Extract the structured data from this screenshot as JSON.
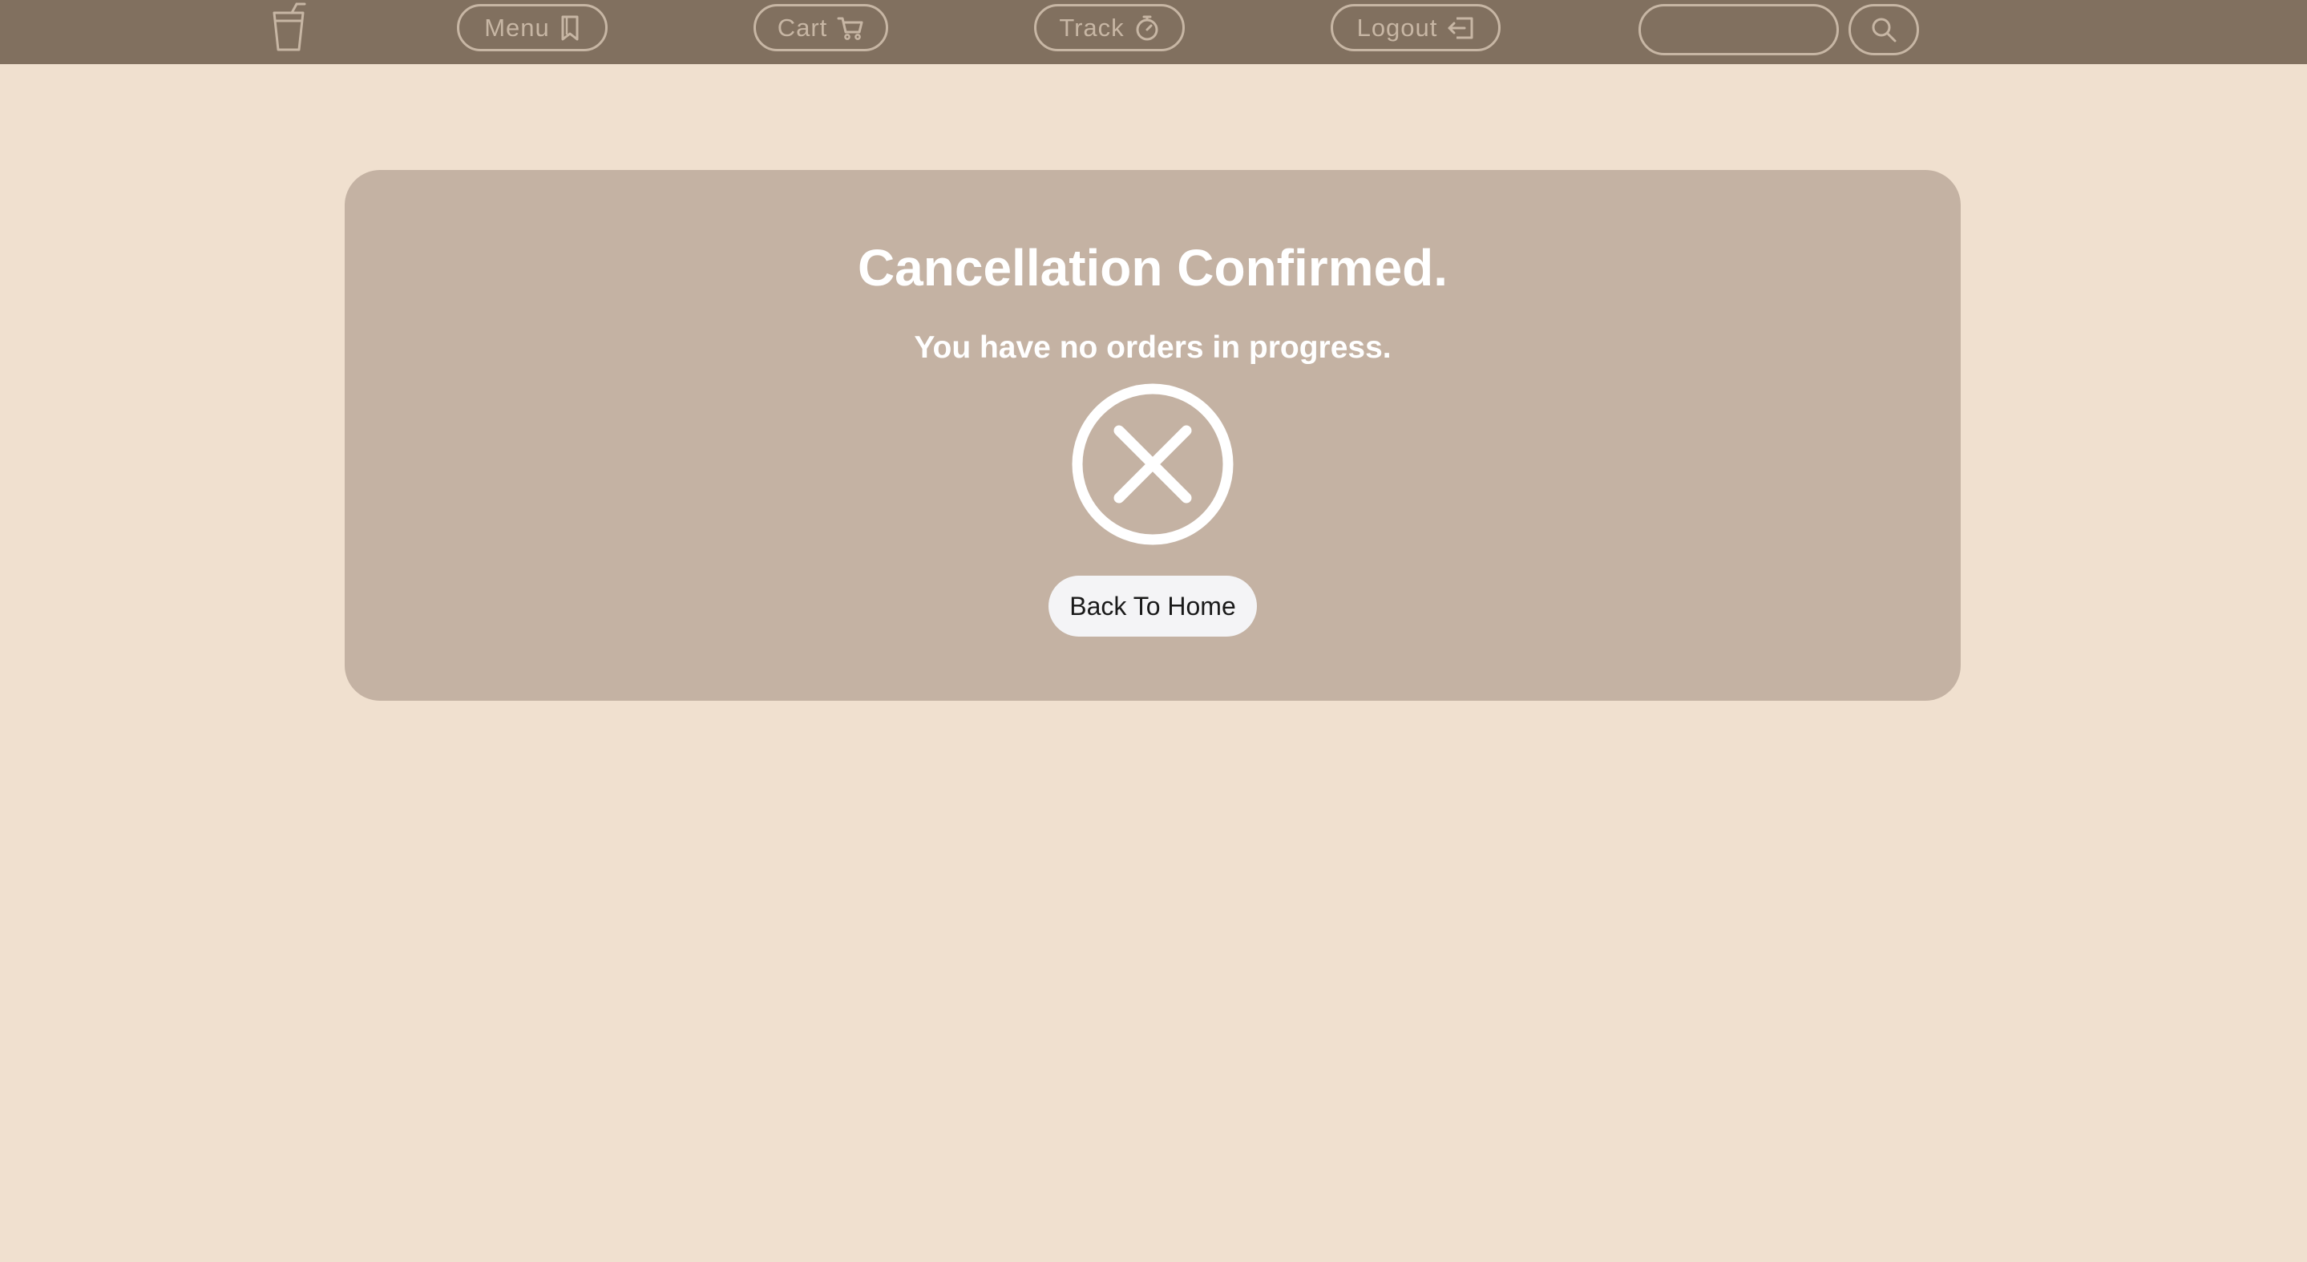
{
  "navbar": {
    "logo_icon": "cup-icon",
    "items": [
      {
        "label": "Menu",
        "icon": "bookmark-icon"
      },
      {
        "label": "Cart",
        "icon": "cart-icon"
      },
      {
        "label": "Track",
        "icon": "stopwatch-icon"
      },
      {
        "label": "Logout",
        "icon": "logout-icon"
      }
    ],
    "search": {
      "value": "",
      "placeholder": "",
      "button_icon": "search-icon"
    }
  },
  "main": {
    "title": "Cancellation Confirmed.",
    "message": "You have no orders in progress.",
    "status_icon": "cancel-x-circle-icon",
    "home_button_label": "Back To Home"
  },
  "colors": {
    "page_background": "#f0e0cf",
    "navbar_background": "#81705f",
    "nav_outline": "#c7b6a4",
    "card_background": "#c4b2a3",
    "text_on_card": "#ffffff",
    "button_background": "#f4f4f6"
  }
}
